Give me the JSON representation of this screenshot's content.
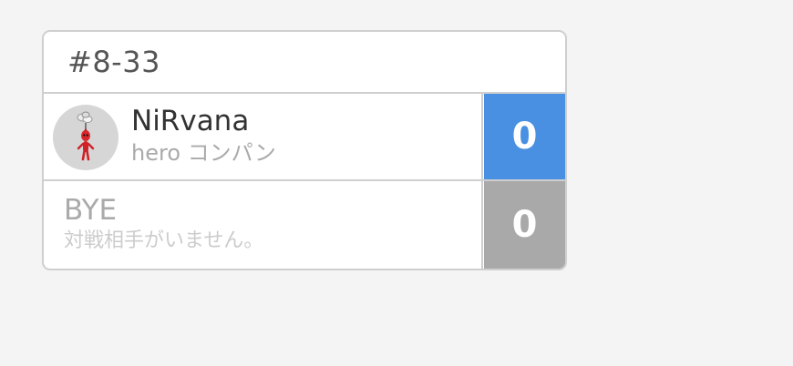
{
  "match": {
    "id": "#8-33"
  },
  "players": [
    {
      "name": "NiRvana",
      "subtitle": "hero コンパン",
      "score": "0",
      "avatar_icon": "pikmin-red-icon",
      "score_color": "#4a90e2"
    },
    {
      "name": "BYE",
      "subtitle": "対戦相手がいません。",
      "score": "0",
      "score_color": "#a9a9a9"
    }
  ]
}
